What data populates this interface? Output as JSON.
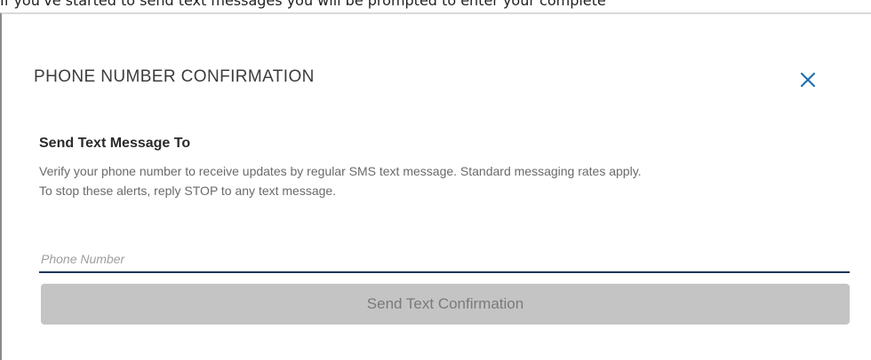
{
  "background_text": "If you've started to send text messages you will be prompted to enter your complete",
  "modal": {
    "title": "PHONE NUMBER CONFIRMATION",
    "close_icon": "close-icon",
    "accent_color": "#1f6fb2"
  },
  "section": {
    "heading": "Send Text Message To",
    "description_line1": "Verify your phone number to receive updates by regular SMS text message. Standard messaging rates apply.",
    "description_line2": "To stop these alerts, reply STOP to any text message."
  },
  "phone_input": {
    "placeholder": "Phone Number",
    "value": ""
  },
  "send_button": {
    "label": "Send Text Confirmation",
    "disabled": true
  }
}
